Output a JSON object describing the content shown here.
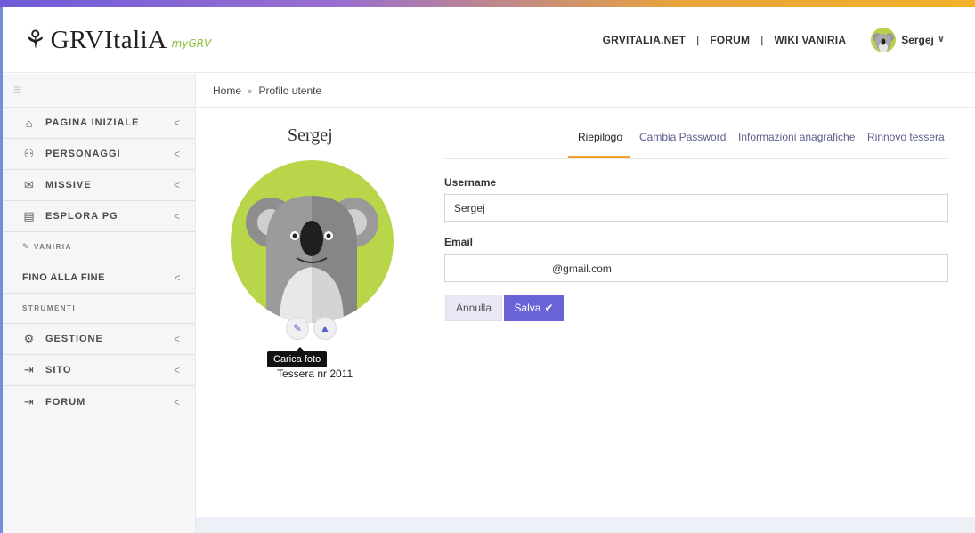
{
  "header": {
    "brand": "GRVItaliA",
    "brand_sub": "myGRV",
    "nav": [
      "GRVITALIA.NET",
      "FORUM",
      "WIKI VANIRIA"
    ],
    "user_name": "Sergej"
  },
  "sidebar": {
    "items": [
      {
        "icon": "home-icon",
        "label": "PAGINA INIZIALE"
      },
      {
        "icon": "users-icon",
        "label": "PERSONAGGI"
      },
      {
        "icon": "mail-icon",
        "label": "MISSIVE"
      },
      {
        "icon": "book-icon",
        "label": "ESPLORA PG"
      }
    ],
    "vaniria": "VANIRIA",
    "fino": "FINO ALLA FINE",
    "strumenti": "STRUMENTI",
    "items2": [
      {
        "icon": "gear-icon",
        "label": "GESTIONE"
      },
      {
        "icon": "login-icon",
        "label": "SITO"
      },
      {
        "icon": "login-icon",
        "label": "FORUM"
      }
    ]
  },
  "breadcrumb": {
    "home": "Home",
    "current": "Profilo utente"
  },
  "profile": {
    "name": "Sergej",
    "tooltip": "Carica foto",
    "tessera": "Tessera nr 2011"
  },
  "tabs": [
    "Riepilogo",
    "Cambia Password",
    "Informazioni anagrafiche",
    "Rinnovo tessera"
  ],
  "form": {
    "username_label": "Username",
    "username_value": "Sergej",
    "email_label": "Email",
    "email_value": "@gmail.com",
    "cancel": "Annulla",
    "save": "Salva"
  }
}
